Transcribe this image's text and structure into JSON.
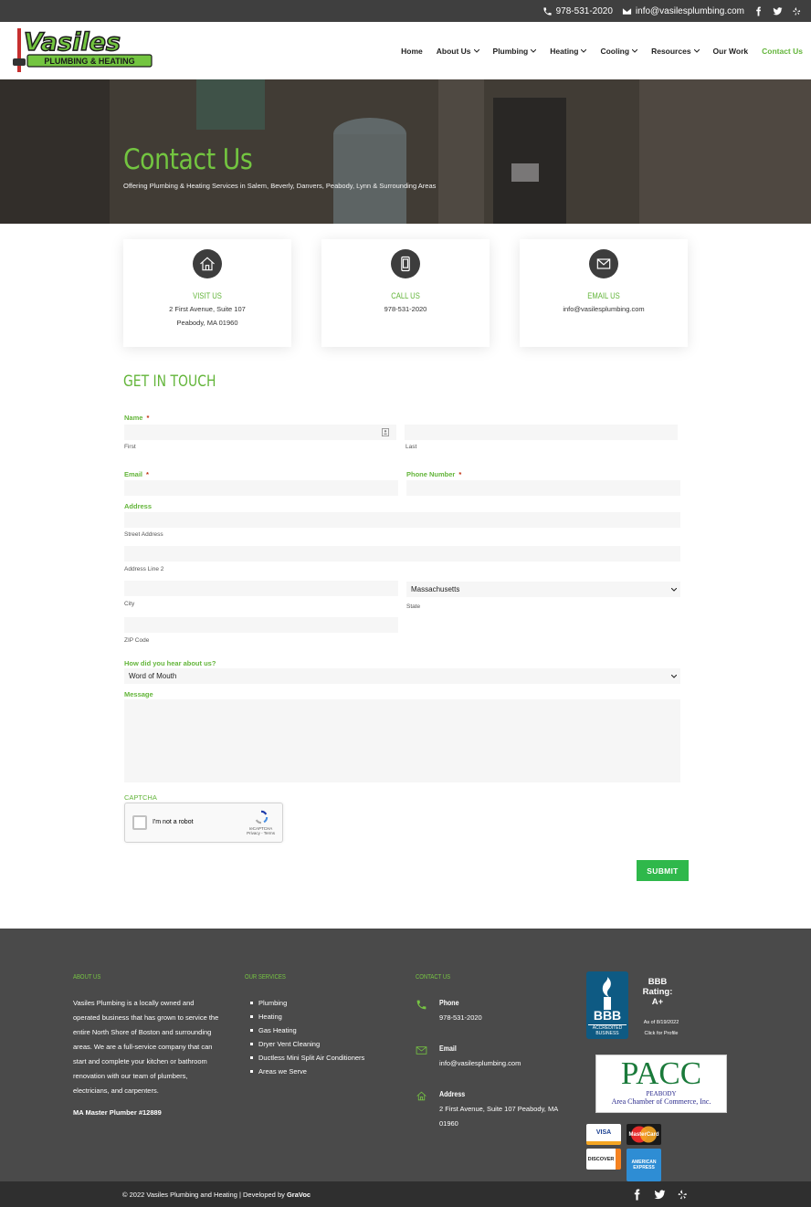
{
  "topbar": {
    "phone": "978-531-2020",
    "email": "info@vasilesplumbing.com"
  },
  "brand": {
    "name": "Vasiles",
    "tagline": "PLUMBING & HEATING",
    "accent": "#73c540"
  },
  "nav": [
    {
      "label": "Home",
      "dropdown": false,
      "active": false
    },
    {
      "label": "About Us",
      "dropdown": true,
      "active": false
    },
    {
      "label": "Plumbing",
      "dropdown": true,
      "active": false
    },
    {
      "label": "Heating",
      "dropdown": true,
      "active": false
    },
    {
      "label": "Cooling",
      "dropdown": true,
      "active": false
    },
    {
      "label": "Resources",
      "dropdown": true,
      "active": false
    },
    {
      "label": "Our Work",
      "dropdown": false,
      "active": false
    },
    {
      "label": "Contact Us",
      "dropdown": false,
      "active": true
    }
  ],
  "hero": {
    "title": "Contact Us",
    "subtitle": "Offering Plumbing & Heating Services in Salem, Beverly, Danvers, Peabody, Lynn & Surrounding Areas"
  },
  "cards": {
    "visit": {
      "title": "VISIT US",
      "line1": "2 First Avenue, Suite 107",
      "line2": "Peabody, MA 01960"
    },
    "call": {
      "title": "CALL US",
      "line1": "978-531-2020"
    },
    "email": {
      "title": "EMAIL US",
      "line1": "info@vasilesplumbing.com"
    }
  },
  "form": {
    "heading": "GET IN TOUCH",
    "name_label": "Name",
    "first": "First",
    "last": "Last",
    "email_label": "Email",
    "phone_label": "Phone Number",
    "address_label": "Address",
    "street": "Street Address",
    "line2": "Address Line 2",
    "city": "City",
    "state": "State",
    "state_value": "Massachusetts",
    "zip": "ZIP Code",
    "hear_label": "How did you hear about us?",
    "hear_value": "Word of Mouth",
    "message_label": "Message",
    "captcha_label": "CAPTCHA",
    "captcha_text": "I'm not a robot",
    "captcha_brand": "reCAPTCHA",
    "captcha_links": "Privacy - Terms",
    "required_mark": "*",
    "submit": "SUBMIT"
  },
  "footer": {
    "about_title": "ABOUT US",
    "about_text": "Vasiles Plumbing is a locally owned and operated business that has grown to service the entire North Shore of Boston and surrounding areas. We are a full-service company that can start and complete your kitchen or bathroom renovation with our team of plumbers, electricians, and carpenters.",
    "license": "MA Master Plumber #12889",
    "services_title": "OUR SERVICES",
    "services": [
      "Plumbing",
      "Heating",
      "Gas Heating",
      "Dryer Vent Cleaning",
      "Ductless Mini Split Air Conditioners",
      "Areas we Serve"
    ],
    "contact_title": "CONTACT US",
    "phone_title": "Phone",
    "phone": "978-531-2020",
    "email_title": "Email",
    "email": "info@vasilesplumbing.com",
    "address_title": "Address",
    "address": "2 First Avenue, Suite 107 Peabody, MA 01960",
    "bbb_rating": "BBB Rating: A+",
    "bbb_date": "As of 8/19/2022",
    "bbb_click": "Click for Profile",
    "bbb_logo": "BBB",
    "bbb_badge": "ACCREDITED BUSINESS",
    "pacc_title": "PACC",
    "pacc_sub": "PEABODY",
    "pacc_name": "Area Chamber of Commerce, Inc.",
    "payments": [
      "VISA",
      "MasterCard",
      "DISCOVER",
      "AMERICAN EXPRESS"
    ]
  },
  "copyright": {
    "text": "© 2022 Vasiles Plumbing and Heating | Developed by ",
    "dev": "GraVoc"
  }
}
